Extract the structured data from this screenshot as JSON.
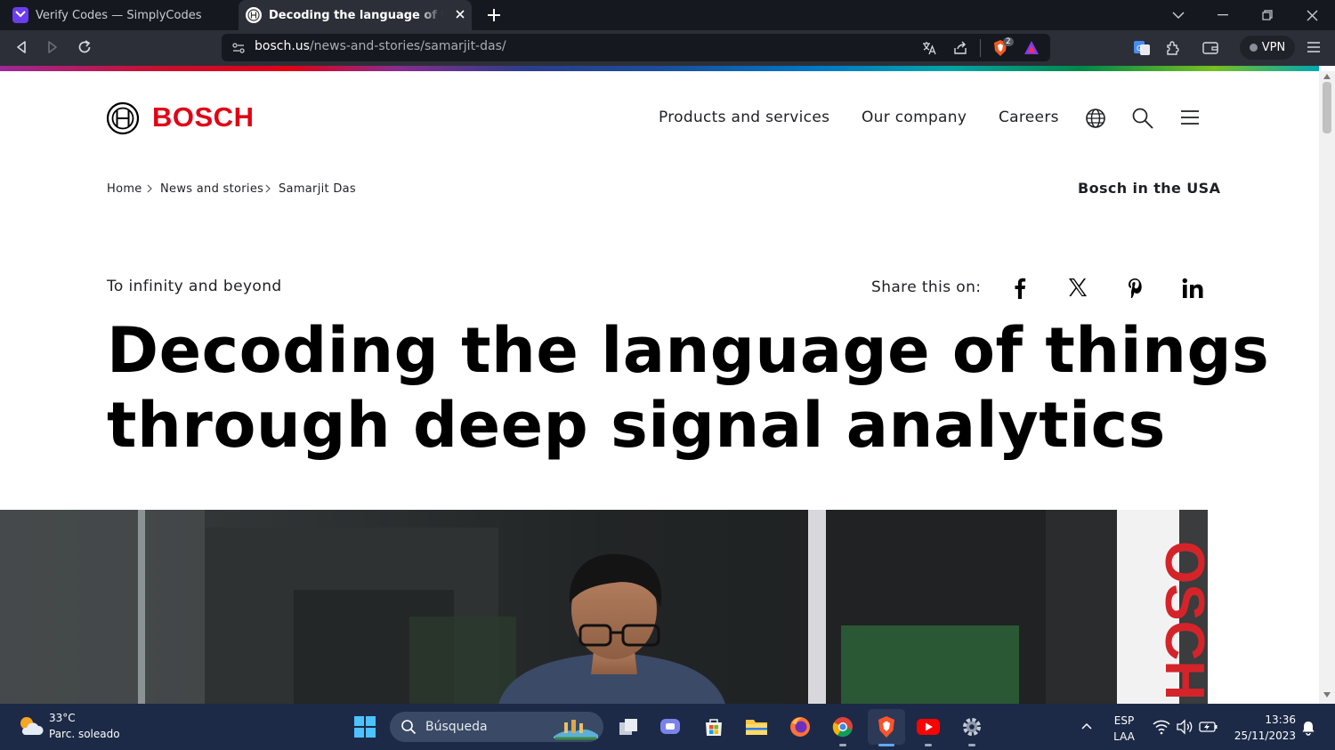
{
  "browser": {
    "tabs": [
      {
        "title": "Verify Codes — SimplyCodes",
        "active": false
      },
      {
        "title": "Decoding the language of things",
        "active": true
      }
    ],
    "url": {
      "host": "bosch.us",
      "path": "/news-and-stories/samarjit-das/"
    },
    "shields_badge": "2",
    "vpn_label": "VPN",
    "accent_color": "#e20015"
  },
  "site": {
    "brand": "BOSCH",
    "nav": [
      "Products and services",
      "Our company",
      "Careers"
    ],
    "breadcrumb": [
      "Home",
      "News and stories",
      "Samarjit Das"
    ],
    "country": "Bosch in the USA"
  },
  "article": {
    "kicker": "To infinity and beyond",
    "share_label": "Share this on:",
    "headline_line1": "Decoding the language of things",
    "headline_line2": "through deep signal analytics",
    "hero_sign": "OSCH"
  },
  "taskbar": {
    "weather_temp": "33°C",
    "weather_condition": "Parc. soleado",
    "search_placeholder": "Búsqueda",
    "language": "ESP",
    "layout": "LAA",
    "time": "13:36",
    "date": "25/11/2023"
  }
}
